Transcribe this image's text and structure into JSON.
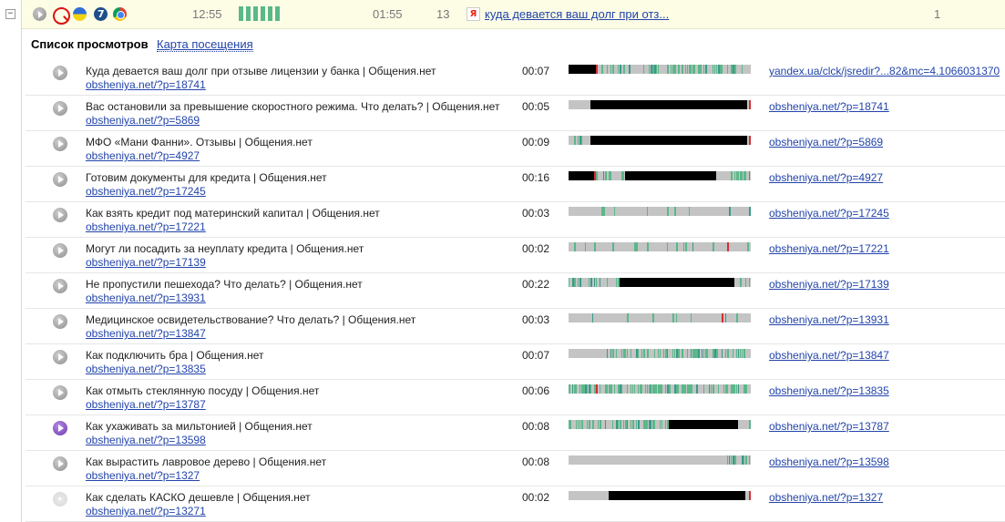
{
  "topbar": {
    "icons": [
      "play-icon",
      "search-icon",
      "flag-icon",
      "os-icon",
      "browser-icon"
    ],
    "time_start": "12:55",
    "activity_segments": 6,
    "duration": "01:55",
    "pages_viewed": "13",
    "current_title": "куда девается ваш долг при отз...",
    "page_count": "1"
  },
  "heading": "Список просмотров",
  "visit_map_link": "Карта посещения",
  "colors": {
    "accent": "#2244aa",
    "activity_green": "#5ab88a",
    "activity_teal": "#3a9a8a",
    "inactive": "#000000",
    "click_red": "#d23030",
    "track": "#c4c4c4"
  },
  "views": [
    {
      "title": "Куда девается ваш долг при отзыве лицензии у банка | Общения.нет",
      "url": "obsheniya.net/?p=18741",
      "duration": "00:07",
      "referrer": "yandex.ua/clck/jsredir?...82&mc=4.1066031370",
      "state": "normal",
      "segments": [
        {
          "s": 0,
          "e": 15,
          "t": "idle"
        },
        {
          "s": 15,
          "e": 16,
          "t": "click"
        },
        {
          "s": 18,
          "e": 100,
          "t": "green"
        }
      ]
    },
    {
      "title": "Вас остановили за превышение скоростного режима. Что делать? | Общения.нет",
      "url": "obsheniya.net/?p=5869",
      "duration": "00:05",
      "referrer": "obsheniya.net/?p=18741",
      "state": "normal",
      "segments": [
        {
          "s": 12,
          "e": 98,
          "t": "idle"
        },
        {
          "s": 99,
          "e": 100,
          "t": "click"
        }
      ]
    },
    {
      "title": "МФО «Мани Фанни». Отзывы | Общения.нет",
      "url": "obsheniya.net/?p=4927",
      "duration": "00:09",
      "referrer": "obsheniya.net/?p=5869",
      "state": "normal",
      "segments": [
        {
          "s": 2,
          "e": 9,
          "t": "green"
        },
        {
          "s": 12,
          "e": 98,
          "t": "idle"
        },
        {
          "s": 99,
          "e": 100,
          "t": "click"
        }
      ]
    },
    {
      "title": "Готовим документы для кредита | Общения.нет",
      "url": "obsheniya.net/?p=17245",
      "duration": "00:16",
      "referrer": "obsheniya.net/?p=4927",
      "state": "normal",
      "segments": [
        {
          "s": 0,
          "e": 14,
          "t": "idle"
        },
        {
          "s": 14,
          "e": 15,
          "t": "click"
        },
        {
          "s": 15,
          "e": 31,
          "t": "green"
        },
        {
          "s": 31,
          "e": 81,
          "t": "idle"
        },
        {
          "s": 84,
          "e": 100,
          "t": "green"
        }
      ]
    },
    {
      "title": "Как взять кредит под материнский капитал | Общения.нет",
      "url": "obsheniya.net/?p=17221",
      "duration": "00:03",
      "referrer": "obsheniya.net/?p=17245",
      "state": "normal",
      "segments": [
        {
          "s": 0,
          "e": 100,
          "t": "sparse"
        }
      ]
    },
    {
      "title": "Могут ли посадить за неуплату кредита | Общения.нет",
      "url": "obsheniya.net/?p=17139",
      "duration": "00:02",
      "referrer": "obsheniya.net/?p=17221",
      "state": "normal",
      "segments": [
        {
          "s": 0,
          "e": 100,
          "t": "sparse"
        },
        {
          "s": 87,
          "e": 88,
          "t": "click"
        }
      ]
    },
    {
      "title": "Не пропустили пешехода? Что делать? | Общения.нет",
      "url": "obsheniya.net/?p=13931",
      "duration": "00:22",
      "referrer": "obsheniya.net/?p=17139",
      "state": "normal",
      "segments": [
        {
          "s": 0,
          "e": 28,
          "t": "green"
        },
        {
          "s": 28,
          "e": 91,
          "t": "idle"
        },
        {
          "s": 93,
          "e": 100,
          "t": "green"
        }
      ]
    },
    {
      "title": "Медицинское освидетельствование? Что делать? | Общения.нет",
      "url": "obsheniya.net/?p=13847",
      "duration": "00:03",
      "referrer": "obsheniya.net/?p=13931",
      "state": "normal",
      "segments": [
        {
          "s": 0,
          "e": 100,
          "t": "sparse"
        },
        {
          "s": 84,
          "e": 85,
          "t": "click"
        }
      ]
    },
    {
      "title": "Как подключить бра | Общения.нет",
      "url": "obsheniya.net/?p=13835",
      "duration": "00:07",
      "referrer": "obsheniya.net/?p=13847",
      "state": "normal",
      "segments": [
        {
          "s": 18,
          "e": 100,
          "t": "green"
        }
      ]
    },
    {
      "title": "Как отмыть стеклянную посуду | Общения.нет",
      "url": "obsheniya.net/?p=13787",
      "duration": "00:06",
      "referrer": "obsheniya.net/?p=13835",
      "state": "normal",
      "segments": [
        {
          "s": 0,
          "e": 100,
          "t": "green"
        },
        {
          "s": 15,
          "e": 16,
          "t": "click"
        }
      ]
    },
    {
      "title": "Как ухаживать за мильтонией | Общения.нет",
      "url": "obsheniya.net/?p=13598",
      "duration": "00:08",
      "referrer": "obsheniya.net/?p=13787",
      "state": "active",
      "segments": [
        {
          "s": 0,
          "e": 55,
          "t": "green"
        },
        {
          "s": 55,
          "e": 93,
          "t": "idle"
        },
        {
          "s": 95,
          "e": 100,
          "t": "green"
        }
      ]
    },
    {
      "title": "Как вырастить лавровое дерево | Общения.нет",
      "url": "obsheniya.net/?p=1327",
      "duration": "00:08",
      "referrer": "obsheniya.net/?p=13598",
      "state": "normal",
      "segments": [
        {
          "s": 86,
          "e": 100,
          "t": "green"
        }
      ]
    },
    {
      "title": "Как сделать КАСКО дешевле | Общения.нет",
      "url": "obsheniya.net/?p=13271",
      "duration": "00:02",
      "referrer": "obsheniya.net/?p=1327",
      "state": "disabled",
      "segments": [
        {
          "s": 22,
          "e": 97,
          "t": "idle"
        },
        {
          "s": 99,
          "e": 100,
          "t": "click"
        }
      ]
    }
  ]
}
